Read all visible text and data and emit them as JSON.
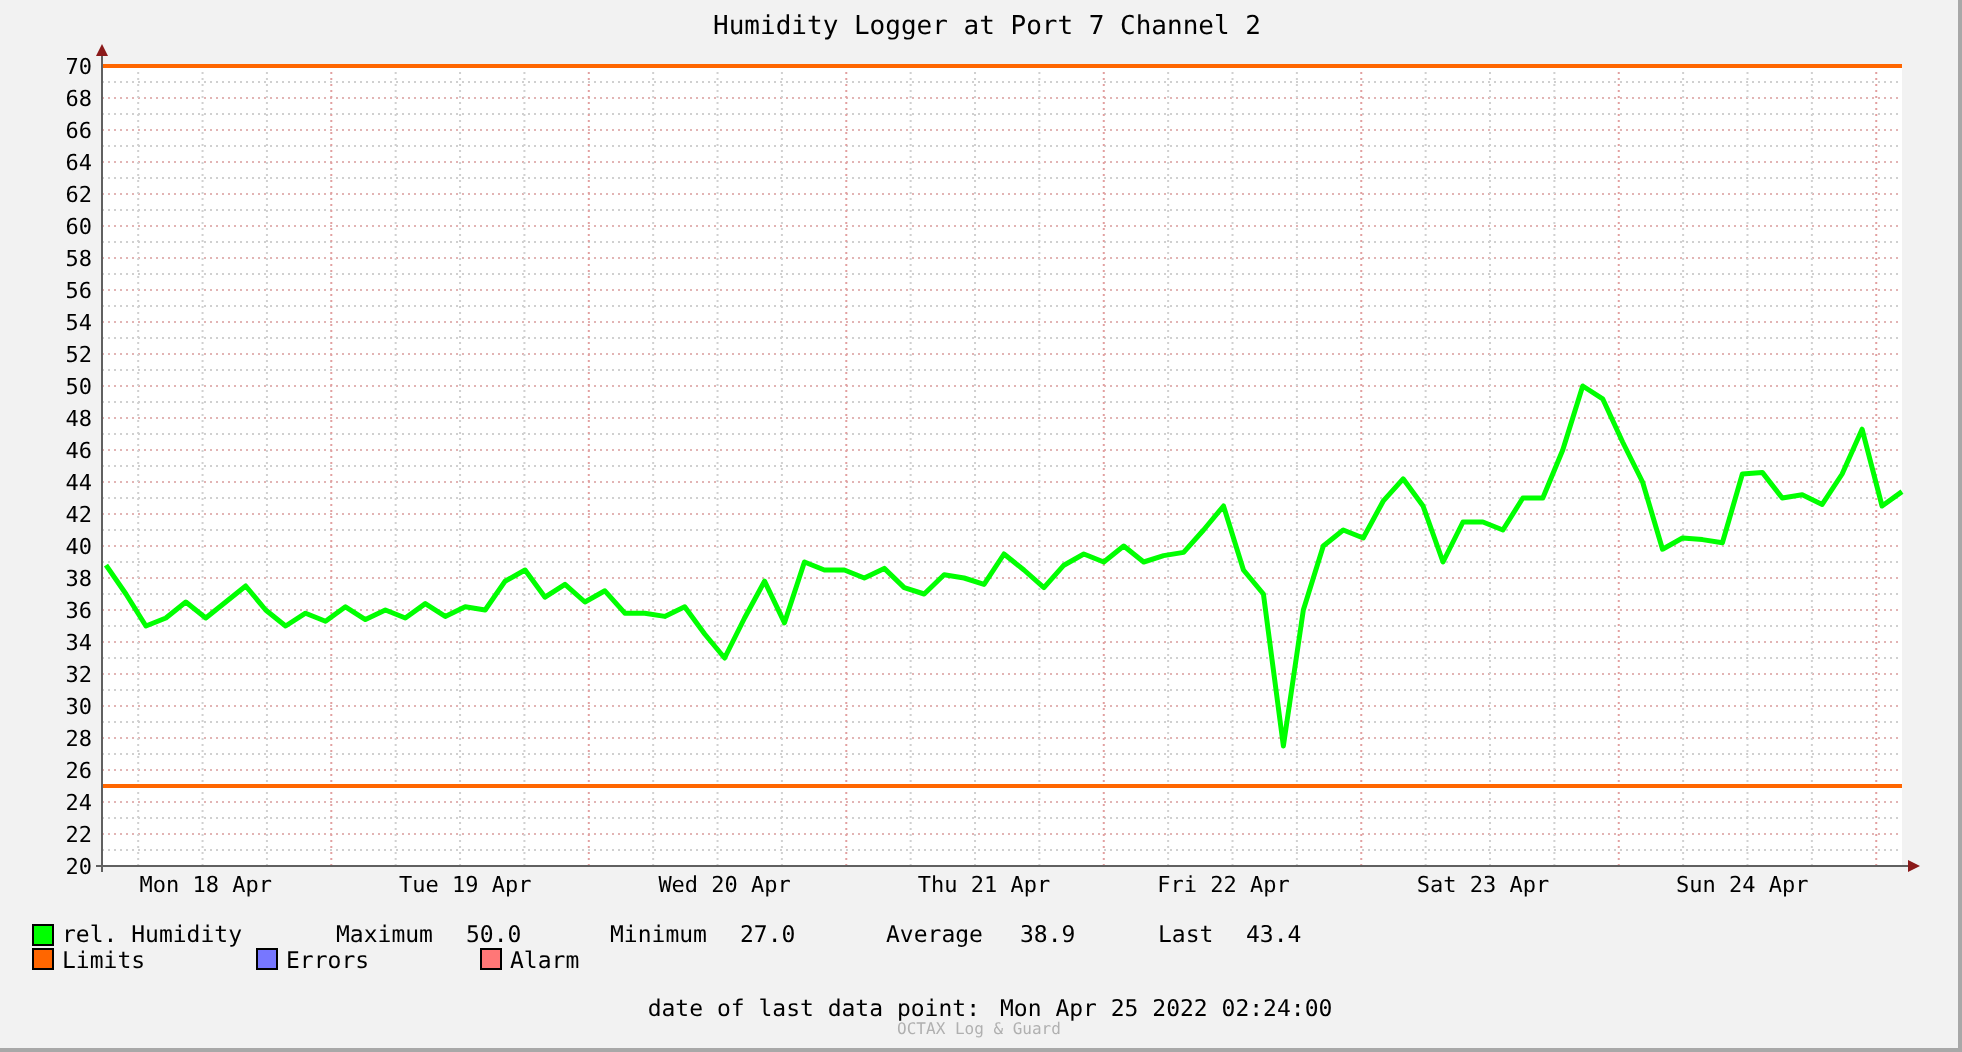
{
  "chart": {
    "chart_data": {
      "type": "line",
      "title": "Humidity Logger at Port 7 Channel 2",
      "grid": true,
      "ylim": [
        20,
        70
      ],
      "categories": [
        null,
        null,
        null,
        null,
        null,
        "Mon 18 Apr",
        null,
        null,
        null,
        null,
        null,
        null,
        null,
        null,
        null,
        null,
        null,
        null,
        "Tue 19 Apr",
        null,
        null,
        null,
        null,
        null,
        null,
        null,
        null,
        null,
        null,
        null,
        null,
        "Wed 20 Apr",
        null,
        null,
        null,
        null,
        null,
        null,
        null,
        null,
        null,
        null,
        null,
        null,
        "Thu 21 Apr",
        null,
        null,
        null,
        null,
        null,
        null,
        null,
        null,
        null,
        null,
        null,
        "Fri 22 Apr",
        null,
        null,
        null,
        null,
        null,
        null,
        null,
        null,
        null,
        null,
        null,
        null,
        "Sat 23 Apr",
        null,
        null,
        null,
        null,
        null,
        null,
        null,
        null,
        null,
        null,
        null,
        null,
        "Sun 24 Apr",
        null,
        null,
        null,
        null,
        null,
        null,
        null,
        null
      ],
      "yticks": [
        20,
        22,
        24,
        26,
        28,
        30,
        32,
        34,
        36,
        38,
        40,
        42,
        44,
        46,
        48,
        50,
        52,
        54,
        56,
        58,
        60,
        62,
        64,
        66,
        68,
        70
      ],
      "series": [
        {
          "name": "rel. Humidity",
          "color": "#00ff00",
          "values": [
            38.8,
            37,
            35,
            35.5,
            36.5,
            35.5,
            36.5,
            37.5,
            36,
            35,
            35.8,
            35.3,
            36.2,
            35.4,
            36,
            35.5,
            36.4,
            35.6,
            36.2,
            36,
            37.8,
            38.5,
            36.8,
            37.6,
            36.5,
            37.2,
            35.8,
            35.8,
            35.6,
            36.2,
            34.5,
            33,
            35.5,
            37.8,
            35.2,
            39,
            38.5,
            38.5,
            38,
            38.6,
            37.4,
            37,
            38.2,
            38,
            37.6,
            39.5,
            38.5,
            37.4,
            38.8,
            39.5,
            39,
            40,
            39,
            39.4,
            39.6,
            41,
            42.5,
            38.5,
            37,
            27.5,
            36,
            40,
            41,
            40.5,
            42.8,
            44.2,
            42.5,
            39,
            41.5,
            41.5,
            41,
            43,
            43,
            46,
            50,
            49.2,
            46.5,
            44,
            39.8,
            40.5,
            40.4,
            40.2,
            44.5,
            44.6,
            43,
            43.2,
            42.6,
            44.5,
            47.3,
            42.5,
            43.4
          ]
        }
      ],
      "ref_lines": [
        {
          "axis": "y",
          "value": 70,
          "color": "#ff6600"
        },
        {
          "axis": "y",
          "value": 25,
          "color": "#ff6600"
        }
      ]
    }
  },
  "legend": {
    "items": [
      {
        "label": "Limits",
        "color": "#ff6600"
      },
      {
        "label": "Errors",
        "color": "#7777ff"
      },
      {
        "label": "Alarm",
        "color": "#ff7777"
      }
    ],
    "stats": [
      {
        "label": "Maximum",
        "value": "50.0"
      },
      {
        "label": "Minimum",
        "value": "27.0"
      },
      {
        "label": "Average",
        "value": "38.9"
      },
      {
        "label": "Last",
        "value": "43.4"
      }
    ]
  },
  "footer": {
    "label": "date of last data point:",
    "value": "Mon Apr 25 2022 02:24:00",
    "credit": "OCTAX Log & Guard"
  }
}
